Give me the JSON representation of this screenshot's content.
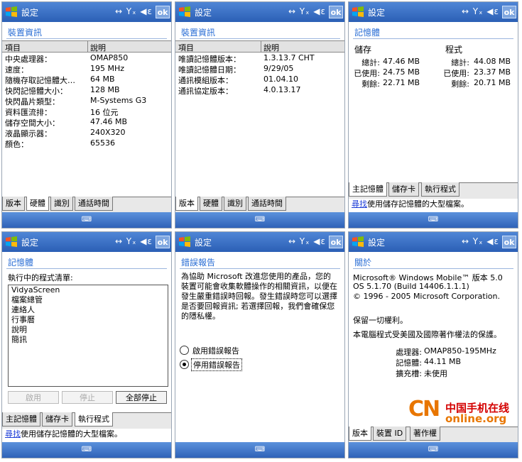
{
  "common": {
    "title": "設定",
    "ok": "ok",
    "status_icons": "↔ Yₓ ◀ε",
    "keyboard": "⌨",
    "colors": {
      "titlebar": "#2b5fb5",
      "accent_link": "#2a6ed5",
      "watermark_orange": "#e87600",
      "watermark_red": "#d40000"
    }
  },
  "p1": {
    "subhead": "裝置資訊",
    "col_item": "項目",
    "col_desc": "說明",
    "rows": [
      {
        "k": "中央處理器：",
        "v": "OMAP850"
      },
      {
        "k": "速度：",
        "v": "195 MHz"
      },
      {
        "k": "隨機存取記憶體大…",
        "v": "64 MB"
      },
      {
        "k": "快閃記憶體大小：",
        "v": "128 MB"
      },
      {
        "k": "快閃晶片類型：",
        "v": "M-Systems G3"
      },
      {
        "k": "資料匯流排：",
        "v": "16 位元"
      },
      {
        "k": "儲存空間大小：",
        "v": "47.46 MB"
      },
      {
        "k": "液晶顯示器：",
        "v": "240X320"
      },
      {
        "k": "顏色：",
        "v": "65536"
      }
    ],
    "tabs": [
      "版本",
      "硬體",
      "識別",
      "通話時間"
    ]
  },
  "p2": {
    "subhead": "裝置資訊",
    "col_item": "項目",
    "col_desc": "說明",
    "rows": [
      {
        "k": "唯讀記憶體版本：",
        "v": "1.3.13.7 CHT"
      },
      {
        "k": "唯讀記憶體日期：",
        "v": "9/29/05"
      },
      {
        "k": "通訊模組版本：",
        "v": "01.04.10"
      },
      {
        "k": "通訊協定版本：",
        "v": "4.0.13.17"
      }
    ],
    "tabs": [
      "版本",
      "硬體",
      "識別",
      "通話時間"
    ]
  },
  "p3": {
    "subhead": "記憶體",
    "storage_header": "儲存",
    "program_header": "程式",
    "storage": [
      {
        "k": "總計:",
        "v": "47.46 MB"
      },
      {
        "k": "已使用:",
        "v": "24.75 MB"
      },
      {
        "k": "剩餘:",
        "v": "22.71 MB"
      }
    ],
    "program": [
      {
        "k": "總計:",
        "v": "44.08 MB"
      },
      {
        "k": "已使用:",
        "v": "23.37 MB"
      },
      {
        "k": "剩餘:",
        "v": "20.71 MB"
      }
    ],
    "tabs": [
      "主記憶體",
      "儲存卡",
      "執行程式"
    ],
    "status_link": "尋找",
    "status_text": "使用儲存記憶體的大型檔案。"
  },
  "p4": {
    "subhead": "記憶體",
    "list_label": "執行中的程式清單:",
    "programs": [
      "VidyaScreen",
      "檔案總管",
      "連絡人",
      "行事曆",
      "說明",
      "簡訊"
    ],
    "btn_activate": "啟用",
    "btn_stop": "停止",
    "btn_stop_all": "全部停止",
    "tabs": [
      "主記憶體",
      "儲存卡",
      "執行程式"
    ],
    "status_link": "尋找",
    "status_text": "使用儲存記憶體的大型檔案。"
  },
  "p5": {
    "subhead": "錯誤報告",
    "paragraph": "為協助 Microsoft 改進您使用的產品，您的裝置可能會收集軟體操作的相關資訊，以便在發生嚴重錯誤時回報。發生錯誤時您可以選擇是否要回報資訊; 若選擇回報，我們會確保您的隱私權。",
    "radio_enable": "啟用錯誤報告",
    "radio_disable": "停用錯誤報告"
  },
  "p6": {
    "subhead": "關於",
    "line1": "Microsoft® Windows Mobile™ 版本 5.0",
    "line2": "OS 5.1.70 (Build 14406.1.1.1)",
    "line3": "© 1996 - 2005 Microsoft Corporation.",
    "rights": "保留一切權利。",
    "law": "本電腦程式受美國及國際著作權法的保護。",
    "specs": [
      {
        "k": "處理器:",
        "v": "OMAP850-195MHz"
      },
      {
        "k": "記憶體:",
        "v": "44.11 MB"
      },
      {
        "k": "擴充槽:",
        "v": "未使用"
      }
    ],
    "tabs": [
      "版本",
      "裝置 ID",
      "著作權"
    ]
  },
  "watermark": {
    "cn": "CN",
    "zh": "中国手机在线",
    "en": "online.org"
  }
}
